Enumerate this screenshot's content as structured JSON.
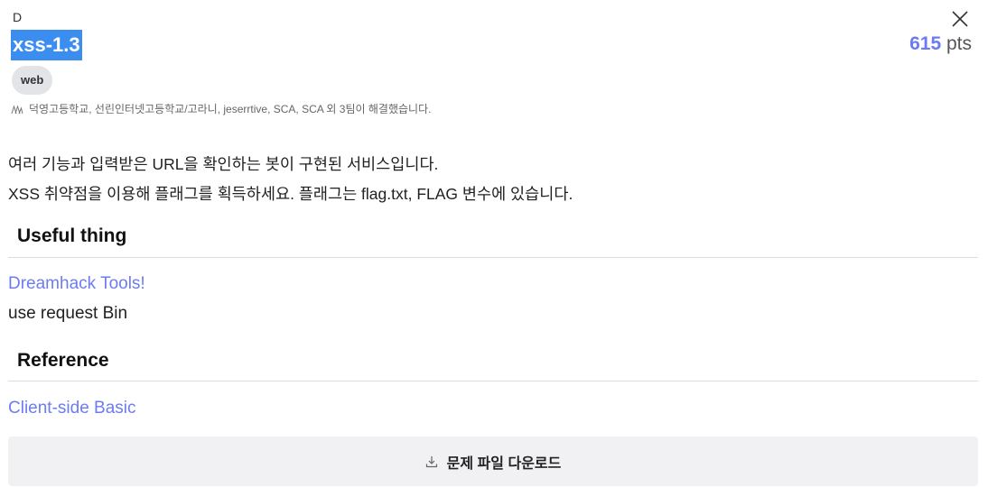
{
  "challenge": {
    "difficulty": "D",
    "title": "xss-1.3",
    "points_value": "615",
    "points_unit": "pts",
    "tag": "web",
    "solvers_text": "덕영고등학교, 선린인터넷고등학교/고라니, jeserrtive, SCA, SCA 외 3팀이 해결했습니다.",
    "description_lines": [
      "여러 기능과 입력받은 URL을 확인하는 봇이 구현된 서비스입니다.",
      "XSS 취약점을 이용해 플래그를 획득하세요. 플래그는 flag.txt, FLAG 변수에 있습니다."
    ]
  },
  "sections": {
    "useful": {
      "heading": "Useful thing",
      "link_label": "Dreamhack Tools!",
      "text": "use request Bin"
    },
    "reference": {
      "heading": "Reference",
      "link_label": "Client-side Basic"
    }
  },
  "download": {
    "label": "문제 파일 다운로드"
  },
  "icons": {
    "close": "close-icon",
    "solvers": "users-icon",
    "download": "download-icon"
  },
  "colors": {
    "accent": "#6c7cf0",
    "title_highlight": "#3b8ef0",
    "tag_bg": "#e3e4e8",
    "download_bg": "#f1f1f3"
  }
}
